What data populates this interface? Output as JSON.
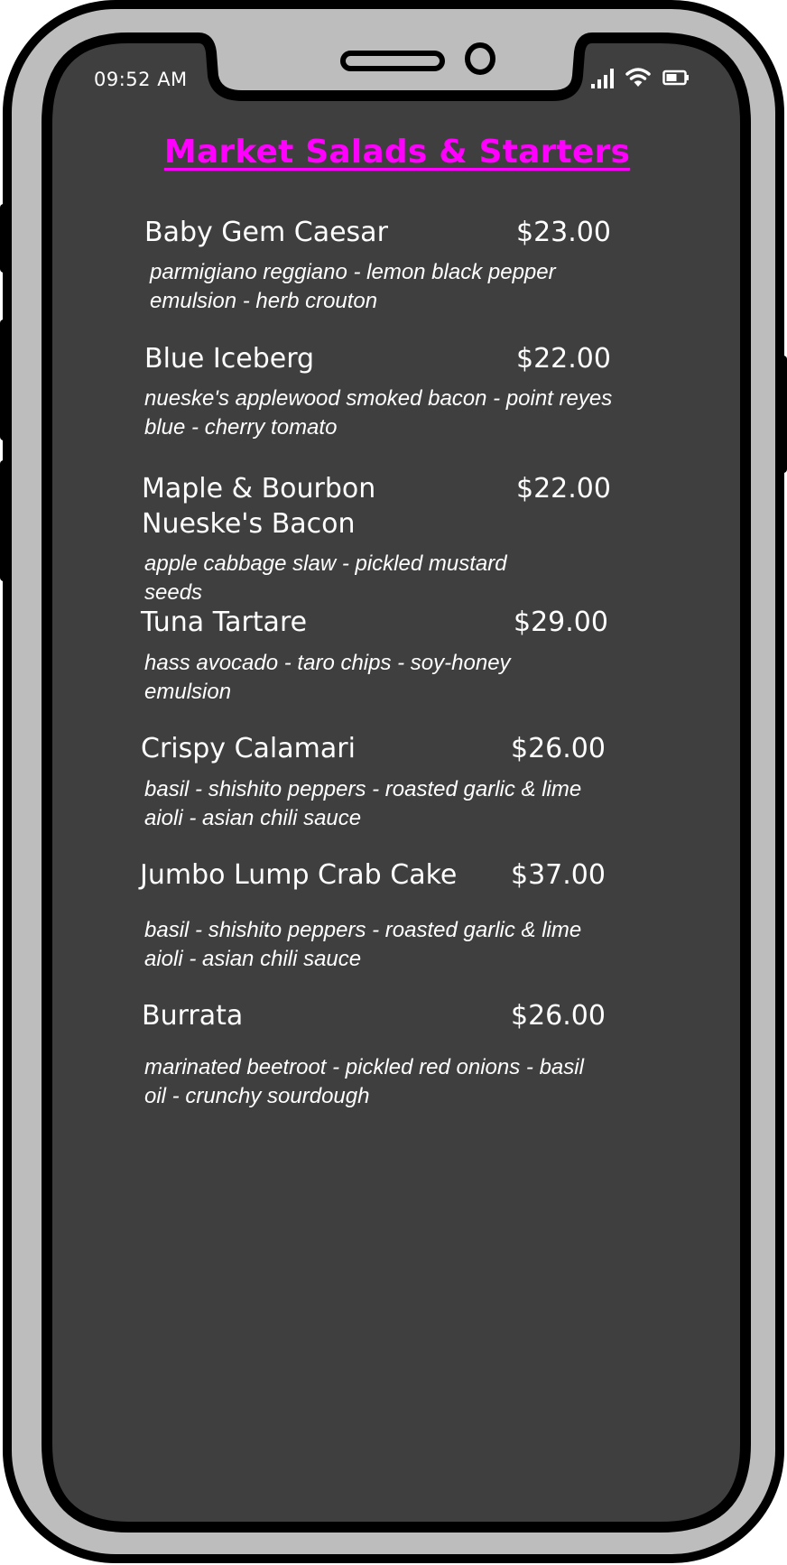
{
  "status_bar": {
    "time": "09:52 AM",
    "signal_icon": "signal-bars-icon",
    "wifi_icon": "wifi-icon",
    "battery_icon": "battery-icon"
  },
  "colors": {
    "frame": "#bdbdbd",
    "screen": "#3f3f3f",
    "title": "#ff00ff",
    "text": "#ffffff"
  },
  "menu": {
    "title": "Market Salads & Starters",
    "items": [
      {
        "name": "Baby Gem Caesar",
        "price": "$23.00",
        "description": "parmigiano reggiano - lemon black pepper emulsion - herb crouton"
      },
      {
        "name": "Blue Iceberg",
        "price": "$22.00",
        "description": "nueske's applewood smoked bacon - point reyes blue - cherry tomato"
      },
      {
        "name": "Maple & Bourbon Nueske's Bacon",
        "price": "$22.00",
        "description": "apple cabbage slaw - pickled mustard seeds"
      },
      {
        "name": "Tuna Tartare",
        "price": "$29.00",
        "description": "hass avocado - taro chips - soy-honey emulsion"
      },
      {
        "name": "Crispy Calamari",
        "price": "$26.00",
        "description": "basil - shishito peppers - roasted garlic & lime aioli - asian chili sauce"
      },
      {
        "name": "Jumbo Lump Crab Cake",
        "price": "$37.00",
        "description": "basil - shishito peppers - roasted garlic & lime aioli - asian chili sauce"
      },
      {
        "name": "Burrata",
        "price": "$26.00",
        "description": "marinated beetroot - pickled red onions - basil oil - crunchy sourdough"
      }
    ]
  }
}
